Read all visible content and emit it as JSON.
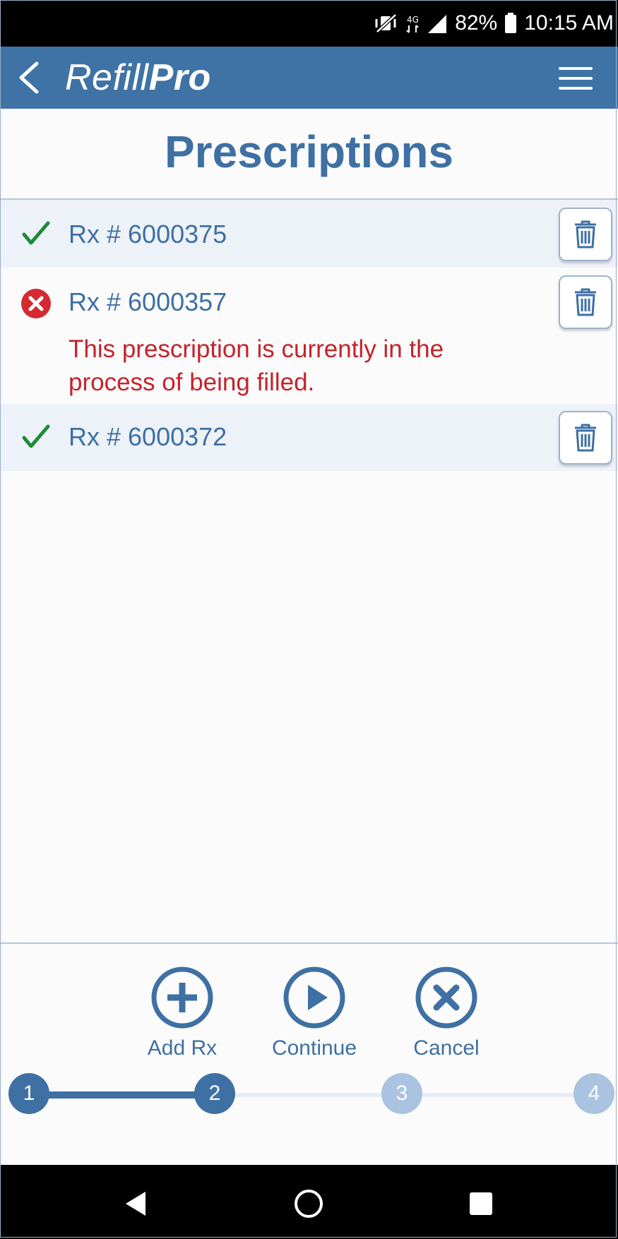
{
  "status_bar": {
    "battery": "82%",
    "time": "10:15 AM",
    "icons": [
      "mute-vibrate-icon",
      "data-icon",
      "signal-icon",
      "battery-icon"
    ]
  },
  "app": {
    "brand_light": "Refill",
    "brand_bold": "Pro",
    "page_title": "Prescriptions"
  },
  "prescriptions": [
    {
      "label": "Rx # 6000375",
      "status": "ok",
      "message": ""
    },
    {
      "label": "Rx # 6000357",
      "status": "error",
      "message": "This prescription is currently in the process of being filled."
    },
    {
      "label": "Rx # 6000372",
      "status": "ok",
      "message": ""
    }
  ],
  "actions": {
    "add": "Add Rx",
    "continue": "Continue",
    "cancel": "Cancel"
  },
  "stepper": {
    "steps": [
      "1",
      "2",
      "3",
      "4"
    ],
    "current": 2
  },
  "colors": {
    "primary": "#3f73a6",
    "text_blue": "#3e70a3",
    "error_red": "#c4232b",
    "ok_green": "#1e8a3a"
  }
}
